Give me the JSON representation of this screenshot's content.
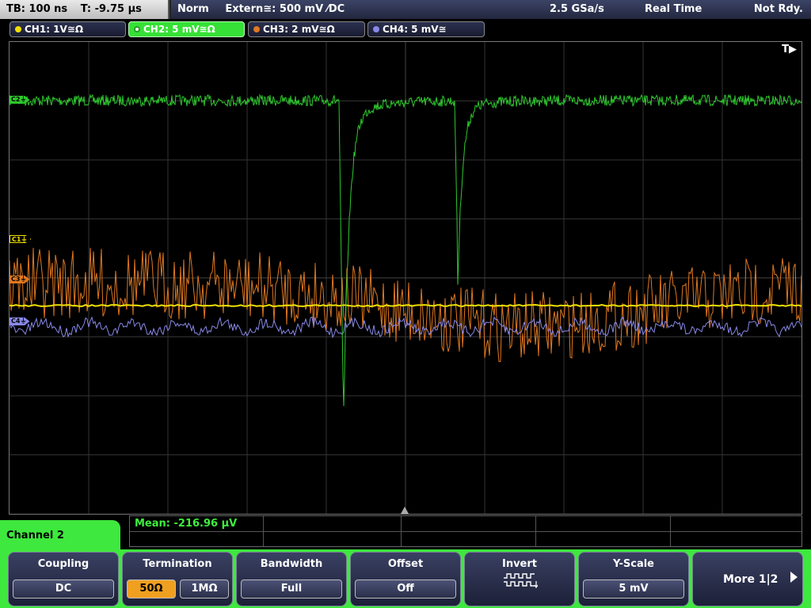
{
  "status": {
    "timebase": "TB: 100 ns",
    "trigger_time": "T: -9.75 µs",
    "trigger_mode": "Norm",
    "trigger_source": "Extern≅: 500 mV ⁄DC",
    "sample_rate": "2.5 GSa/s",
    "acq_mode": "Real Time",
    "trigger_status": "Not Rdy."
  },
  "channels": [
    {
      "label": "CH1: 1V≅Ω",
      "color": "#f0e000",
      "marker": "C1⏚"
    },
    {
      "label": "CH2: 5 mV≅Ω",
      "color": "#2ec82e",
      "marker": "C2⏚"
    },
    {
      "label": "CH3: 2 mV≅Ω",
      "color": "#e07820",
      "marker": "C3⏚"
    },
    {
      "label": "CH4: 5 mV≅",
      "color": "#8888e8",
      "marker": "C4⏚"
    }
  ],
  "display": {
    "trigger_pos_marker": "T▶"
  },
  "measurement": {
    "mean": "Mean: -216.96 µV"
  },
  "menu": {
    "title": "Channel 2",
    "coupling": {
      "label": "Coupling",
      "value": "DC"
    },
    "termination": {
      "label": "Termination",
      "options": [
        "50Ω",
        "1MΩ"
      ],
      "selected": "50Ω"
    },
    "bandwidth": {
      "label": "Bandwidth",
      "value": "Full"
    },
    "offset": {
      "label": "Offset",
      "value": "Off"
    },
    "invert": {
      "label": "Invert",
      "icon": "invert-waveform-icon"
    },
    "yscale": {
      "label": "Y-Scale",
      "value": "5 mV"
    },
    "more": {
      "label": "More 1|2",
      "icon": "arrow-right-icon"
    }
  }
}
